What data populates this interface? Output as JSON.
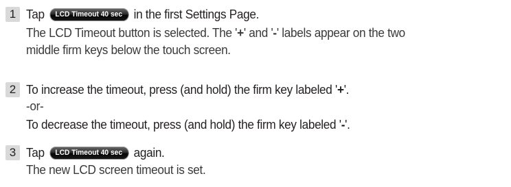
{
  "steps": [
    {
      "number": "1",
      "main_before": "Tap",
      "main_after": "in the first Settings Page.",
      "button": {
        "label": "LCD Timeout",
        "value": "40 sec"
      },
      "sub_line_1_a": "The LCD Timeout button is selected. The '",
      "sub_plus": "+",
      "sub_line_1_b": "' and '",
      "sub_minus": "-",
      "sub_line_1_c": "' labels appear on the two",
      "sub_line_2": "middle firm keys below the touch screen."
    },
    {
      "number": "2",
      "line_1_a": "To increase the timeout, press (and hold) the firm key labeled '",
      "line_1_key": "+",
      "line_1_b": "'.",
      "line_2": "-or-",
      "line_3_a": "To decrease the timeout, press (and hold) the firm key labeled '",
      "line_3_key": "-",
      "line_3_b": "'."
    },
    {
      "number": "3",
      "main_before": "Tap",
      "main_after": "again.",
      "button": {
        "label": "LCD Timeout",
        "value": "40 sec"
      },
      "sub_line_1": "The new LCD screen timeout is set."
    }
  ]
}
